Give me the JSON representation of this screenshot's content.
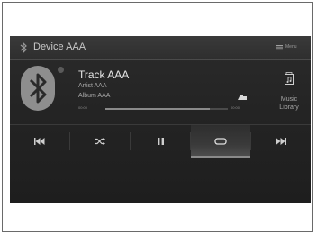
{
  "header": {
    "device_name": "Device AAA",
    "menu_label": "Menu"
  },
  "now_playing": {
    "track": "Track AAA",
    "artist": "Artist AAA",
    "album": "Album AAA",
    "elapsed": "00:00",
    "duration": "00:00",
    "progress_fraction": 0.85
  },
  "library": {
    "label_line1": "Music",
    "label_line2": "Library"
  },
  "controls": {
    "active": "repeat",
    "icons": [
      "skip-back-icon",
      "shuffle-icon",
      "pause-icon",
      "repeat-icon",
      "skip-forward-icon"
    ]
  },
  "colors": {
    "screen_bg": "#242424",
    "text_primary": "#e6e6e6",
    "text_secondary": "#a8a8a8",
    "icon": "#cfcfcf"
  }
}
